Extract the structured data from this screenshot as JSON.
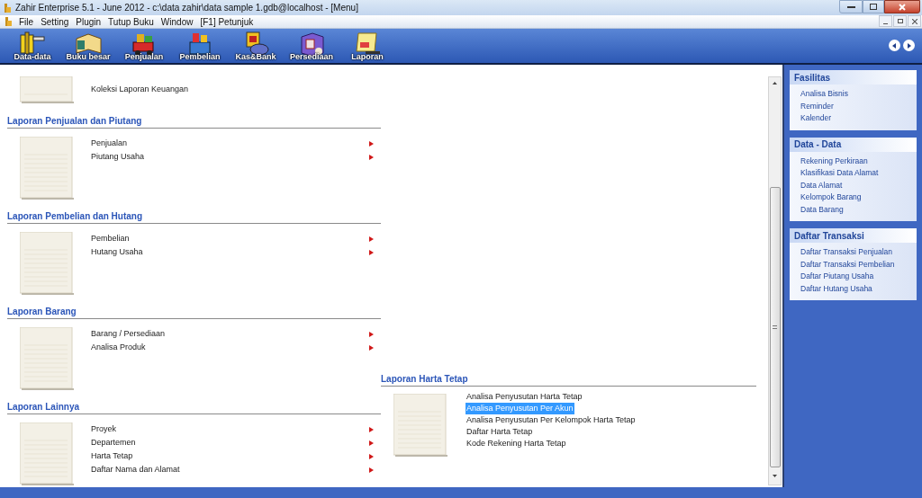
{
  "window": {
    "title": "Zahir Enterprise 5.1 - June 2012 - c:\\data zahir\\data sample 1.gdb@localhost - [Menu]"
  },
  "menu": [
    "File",
    "Setting",
    "Plugin",
    "Tutup Buku",
    "Window",
    "[F1] Petunjuk"
  ],
  "toolbar": [
    "Data-data",
    "Buku besar",
    "Penjualan",
    "Pembelian",
    "Kas&Bank",
    "Persediaan",
    "Laporan"
  ],
  "left_sections": [
    {
      "items": [
        {
          "label": "Koleksi Laporan Keuangan",
          "submenu": false,
          "selected": false
        }
      ]
    },
    {
      "title": "Laporan Penjualan dan Piutang",
      "items": [
        {
          "label": "Penjualan",
          "submenu": true,
          "selected": false
        },
        {
          "label": "Piutang Usaha",
          "submenu": true,
          "selected": false
        }
      ]
    },
    {
      "title": "Laporan Pembelian dan Hutang",
      "items": [
        {
          "label": "Pembelian",
          "submenu": true,
          "selected": false
        },
        {
          "label": "Hutang Usaha",
          "submenu": true,
          "selected": false
        }
      ]
    },
    {
      "title": "Laporan Barang",
      "items": [
        {
          "label": "Barang / Persediaan",
          "submenu": true,
          "selected": false
        },
        {
          "label": "Analisa Produk",
          "submenu": true,
          "selected": false
        }
      ]
    },
    {
      "title": "Laporan Lainnya",
      "items": [
        {
          "label": "Proyek",
          "submenu": true,
          "selected": false
        },
        {
          "label": "Departemen",
          "submenu": true,
          "selected": false
        },
        {
          "label": "Harta Tetap",
          "submenu": true,
          "selected": false
        },
        {
          "label": "Daftar Nama dan Alamat",
          "submenu": true,
          "selected": false
        }
      ]
    }
  ],
  "right_section": {
    "title": "Laporan Harta Tetap",
    "items": [
      {
        "label": "Analisa Penyusutan Harta Tetap",
        "submenu": false,
        "selected": false
      },
      {
        "label": "Analisa Penyusutan Per Akun",
        "submenu": false,
        "selected": true
      },
      {
        "label": "Analisa Penyusutan Per Kelompok Harta Tetap",
        "submenu": false,
        "selected": false
      },
      {
        "label": "Daftar Harta Tetap",
        "submenu": false,
        "selected": false
      },
      {
        "label": "Kode Rekening Harta Tetap",
        "submenu": false,
        "selected": false
      }
    ]
  },
  "sidebar": [
    {
      "title": "Fasilitas",
      "links": [
        "Analisa Bisnis",
        "Reminder",
        "Kalender"
      ]
    },
    {
      "title": "Data - Data",
      "links": [
        "Rekening Perkiraan",
        "Klasifikasi Data Alamat",
        "Data Alamat",
        "Kelompok Barang",
        "Data Barang"
      ]
    },
    {
      "title": "Daftar Transaksi",
      "links": [
        "Daftar Transaksi Penjualan",
        "Daftar Transaksi Pembelian",
        "Daftar Piutang Usaha",
        "Daftar Hutang Usaha"
      ]
    }
  ]
}
